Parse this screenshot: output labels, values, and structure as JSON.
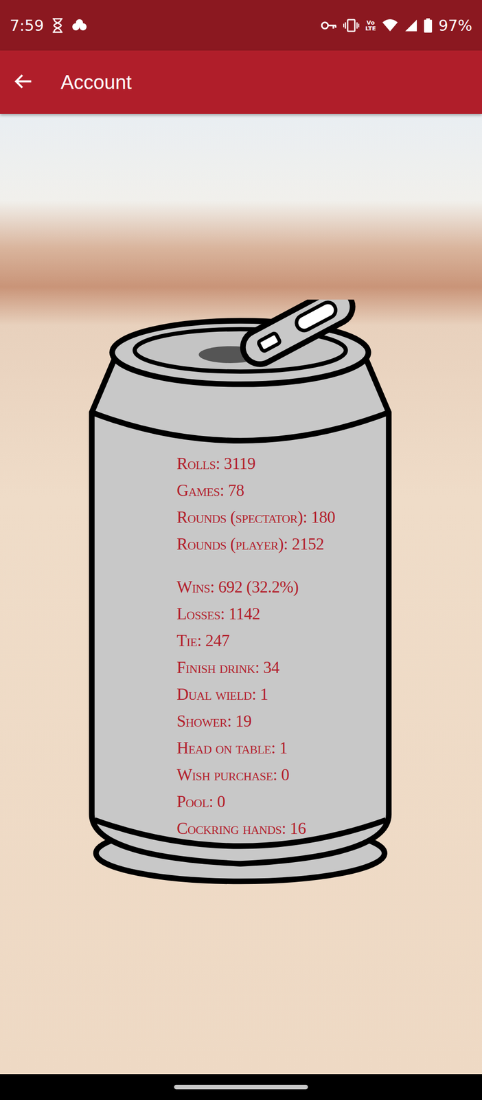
{
  "status_bar": {
    "time": "7:59",
    "volte_top": "Vo",
    "volte_bottom": "LTE",
    "battery": "97%"
  },
  "app_bar": {
    "title": "Account"
  },
  "stat_groups": [
    [
      "Rolls: 3119",
      "Games: 78",
      "Rounds (spectator): 180",
      "Rounds (player): 2152"
    ],
    [
      "Wins: 692 (32.2%)",
      "Losses: 1142",
      "Tie: 247",
      "Finish drink: 34",
      "Dual wield: 1",
      "Shower: 19",
      "Head on table: 1",
      "Wish purchase: 0",
      "Pool: 0",
      "Cockring hands: 16"
    ]
  ]
}
